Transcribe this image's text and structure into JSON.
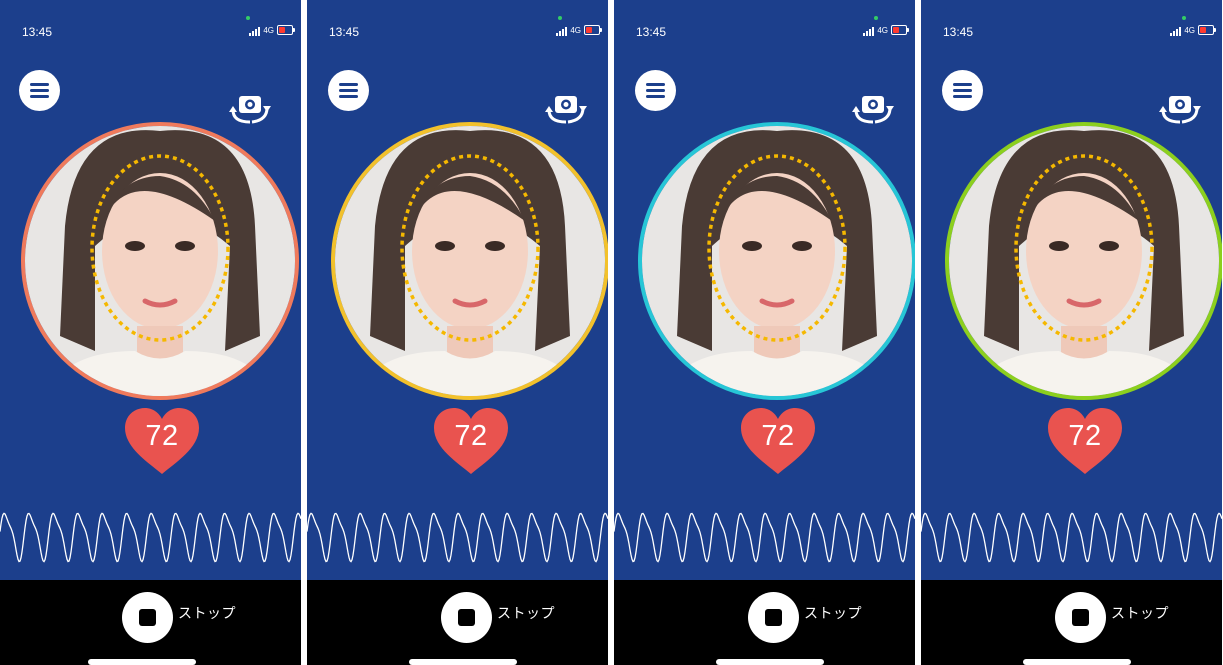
{
  "theme": {
    "screen_background": "#1c3f8c",
    "bottom_bar_background": "#000000",
    "heart_color": "#e9534f",
    "face_guide_color": "#f5b800"
  },
  "screens": [
    {
      "status": {
        "time": "13:45",
        "network": "4G"
      },
      "ring_color": "#ef7a5c",
      "heart_rate": "72",
      "stop_label": "ストップ"
    },
    {
      "status": {
        "time": "13:45",
        "network": "4G"
      },
      "ring_color": "#f2c12c",
      "heart_rate": "72",
      "stop_label": "ストップ"
    },
    {
      "status": {
        "time": "13:45",
        "network": "4G"
      },
      "ring_color": "#27c6d6",
      "heart_rate": "72",
      "stop_label": "ストップ"
    },
    {
      "status": {
        "time": "13:45",
        "network": "4G"
      },
      "ring_color": "#8ccf1e",
      "heart_rate": "72",
      "stop_label": "ストップ"
    }
  ],
  "icons": {
    "menu": "hamburger-menu-icon",
    "flip_camera": "flip-camera-icon",
    "heart": "heart-icon",
    "stop": "stop-icon"
  }
}
